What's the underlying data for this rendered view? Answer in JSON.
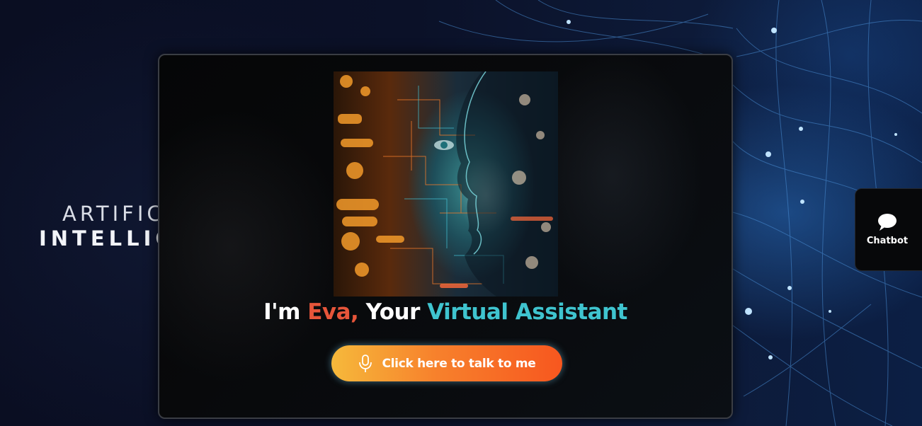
{
  "background": {
    "line1": "ARTIFIC",
    "line2": "INTELLIG"
  },
  "assistant": {
    "greeting_prefix": "I'm ",
    "name": "Eva,",
    "greeting_middle": " Your ",
    "role": "Virtual Assistant",
    "portrait_icon": "ai-woman-portrait",
    "talk_button_label": "Click here to talk to me",
    "mic_icon": "microphone-icon"
  },
  "chatbot": {
    "label": "Chatbot",
    "icon": "chat-bubble-icon"
  },
  "colors": {
    "name_accent": "#e6553a",
    "role_accent": "#3fc4cf",
    "button_start": "#f6b93b",
    "button_end": "#f7571f"
  }
}
